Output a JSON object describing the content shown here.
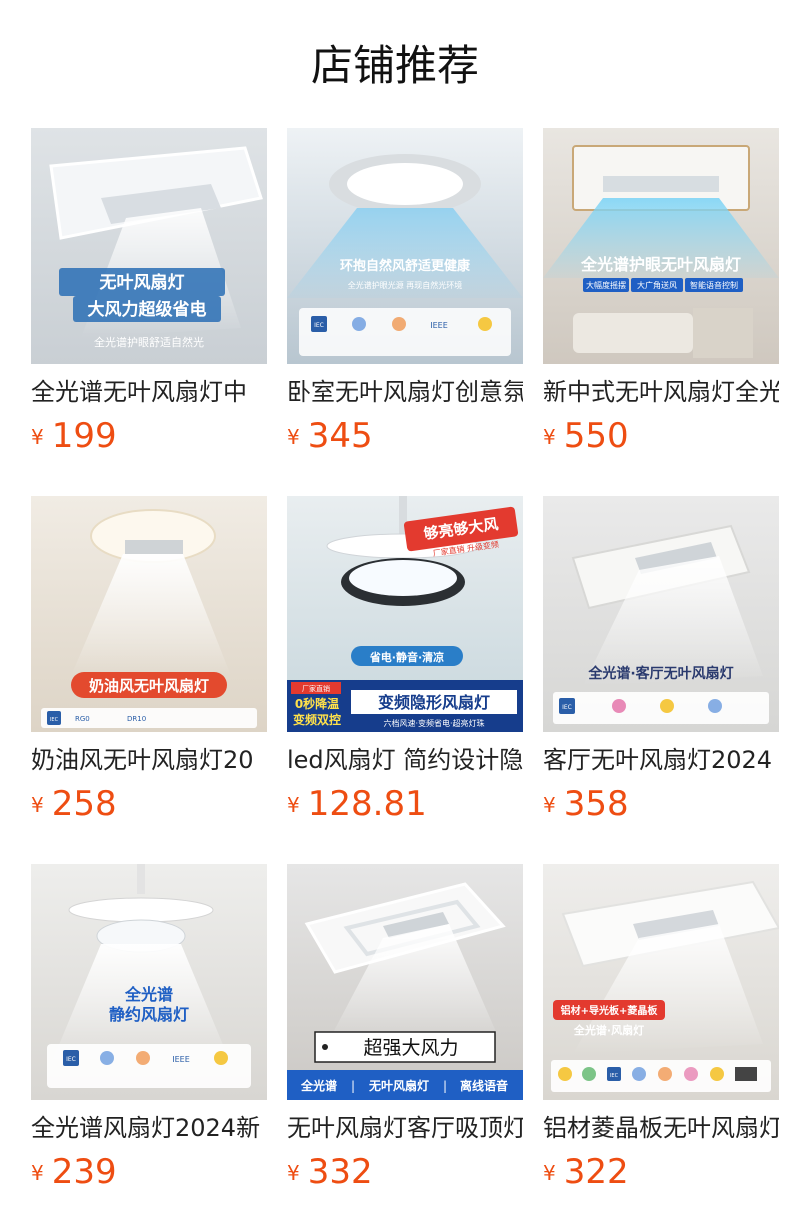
{
  "page_title": "店铺推荐",
  "currency_symbol": "¥",
  "products": [
    {
      "title": "全光谱无叶风扇灯中",
      "price": "199",
      "image_lines": [
        "无叶风扇灯",
        "大风力超级省电",
        "全光谱护眼舒适自然光"
      ]
    },
    {
      "title": "卧室无叶风扇灯创意氛",
      "price": "345",
      "image_lines": [
        "环抱自然风舒适更健康",
        "全光谱护眼光源 再现自然光环境",
        "IEC",
        "IEEE"
      ]
    },
    {
      "title": "新中式无叶风扇灯全光",
      "price": "550",
      "image_lines": [
        "全光谱护眼无叶风扇灯",
        "大幅度摇摆",
        "大广角送风",
        "智能语音控制"
      ]
    },
    {
      "title": "奶油风无叶风扇灯20",
      "price": "258",
      "image_lines": [
        "奶油风无叶风扇灯",
        "IEC",
        "RG0",
        "DR10"
      ]
    },
    {
      "title": "led风扇灯 简约设计隐",
      "price": "128.81",
      "image_lines": [
        "够亮够大风",
        "厂家直销 升级变频",
        "省电·静音·清凉",
        "厂家直销",
        "0秒降温",
        "变频双控",
        "变频隐形风扇灯",
        "六档风速·变频省电·超亮灯珠"
      ]
    },
    {
      "title": "客厅无叶风扇灯2024",
      "price": "358",
      "image_lines": [
        "全光谱·客厅无叶风扇灯",
        "IEC"
      ]
    },
    {
      "title": "全光谱风扇灯2024新",
      "price": "239",
      "image_lines": [
        "全光谱",
        "静约风扇灯",
        "IEC",
        "IEEE"
      ]
    },
    {
      "title": "无叶风扇灯客厅吸顶灯",
      "price": "332",
      "image_lines": [
        "超强大风力",
        "全光谱",
        "无叶风扇灯",
        "离线语音"
      ]
    },
    {
      "title": "铝材菱晶板无叶风扇灯",
      "price": "322",
      "image_lines": [
        "铝材+导光板+菱晶板",
        "全光谱·风扇灯",
        "IEC"
      ]
    }
  ],
  "colors": {
    "price": "#ee4d12",
    "title": "#222222",
    "heading": "#111111"
  }
}
